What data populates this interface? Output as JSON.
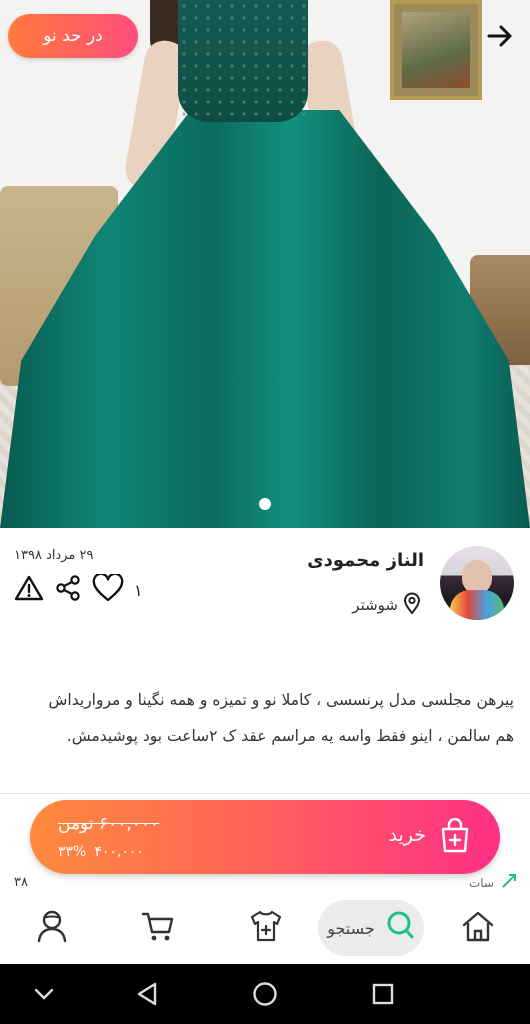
{
  "hero": {
    "badge_label": "در حد نو",
    "back_icon": "arrow-right-icon"
  },
  "seller": {
    "name": "الناز محمودی",
    "city": "شوشتر",
    "date": "۲۹ مرداد ۱۳۹۸",
    "like_count": "۱"
  },
  "description": "پیرهن  مجلسی مدل پرنسسی ، کاملا نو و تمیزه و همه نگینا و مرواریداش هم سالمن ، اینو فقط واسه یه مراسم عقد ک ۲ساعت بود پوشیدمش.",
  "buy": {
    "label": "خرید",
    "old_price": "۶۰۰,۰۰۰ تومن",
    "discount": "۳۳%",
    "new_price": "۴۰۰,۰۰۰"
  },
  "footer": {
    "left_text": "۳۸",
    "right_text": "سات"
  },
  "tabs": {
    "search_label": "جستجو"
  },
  "colors": {
    "accent_start": "#ff8a3d",
    "accent_end": "#ff2f86",
    "search_green": "#1fbf8f"
  }
}
